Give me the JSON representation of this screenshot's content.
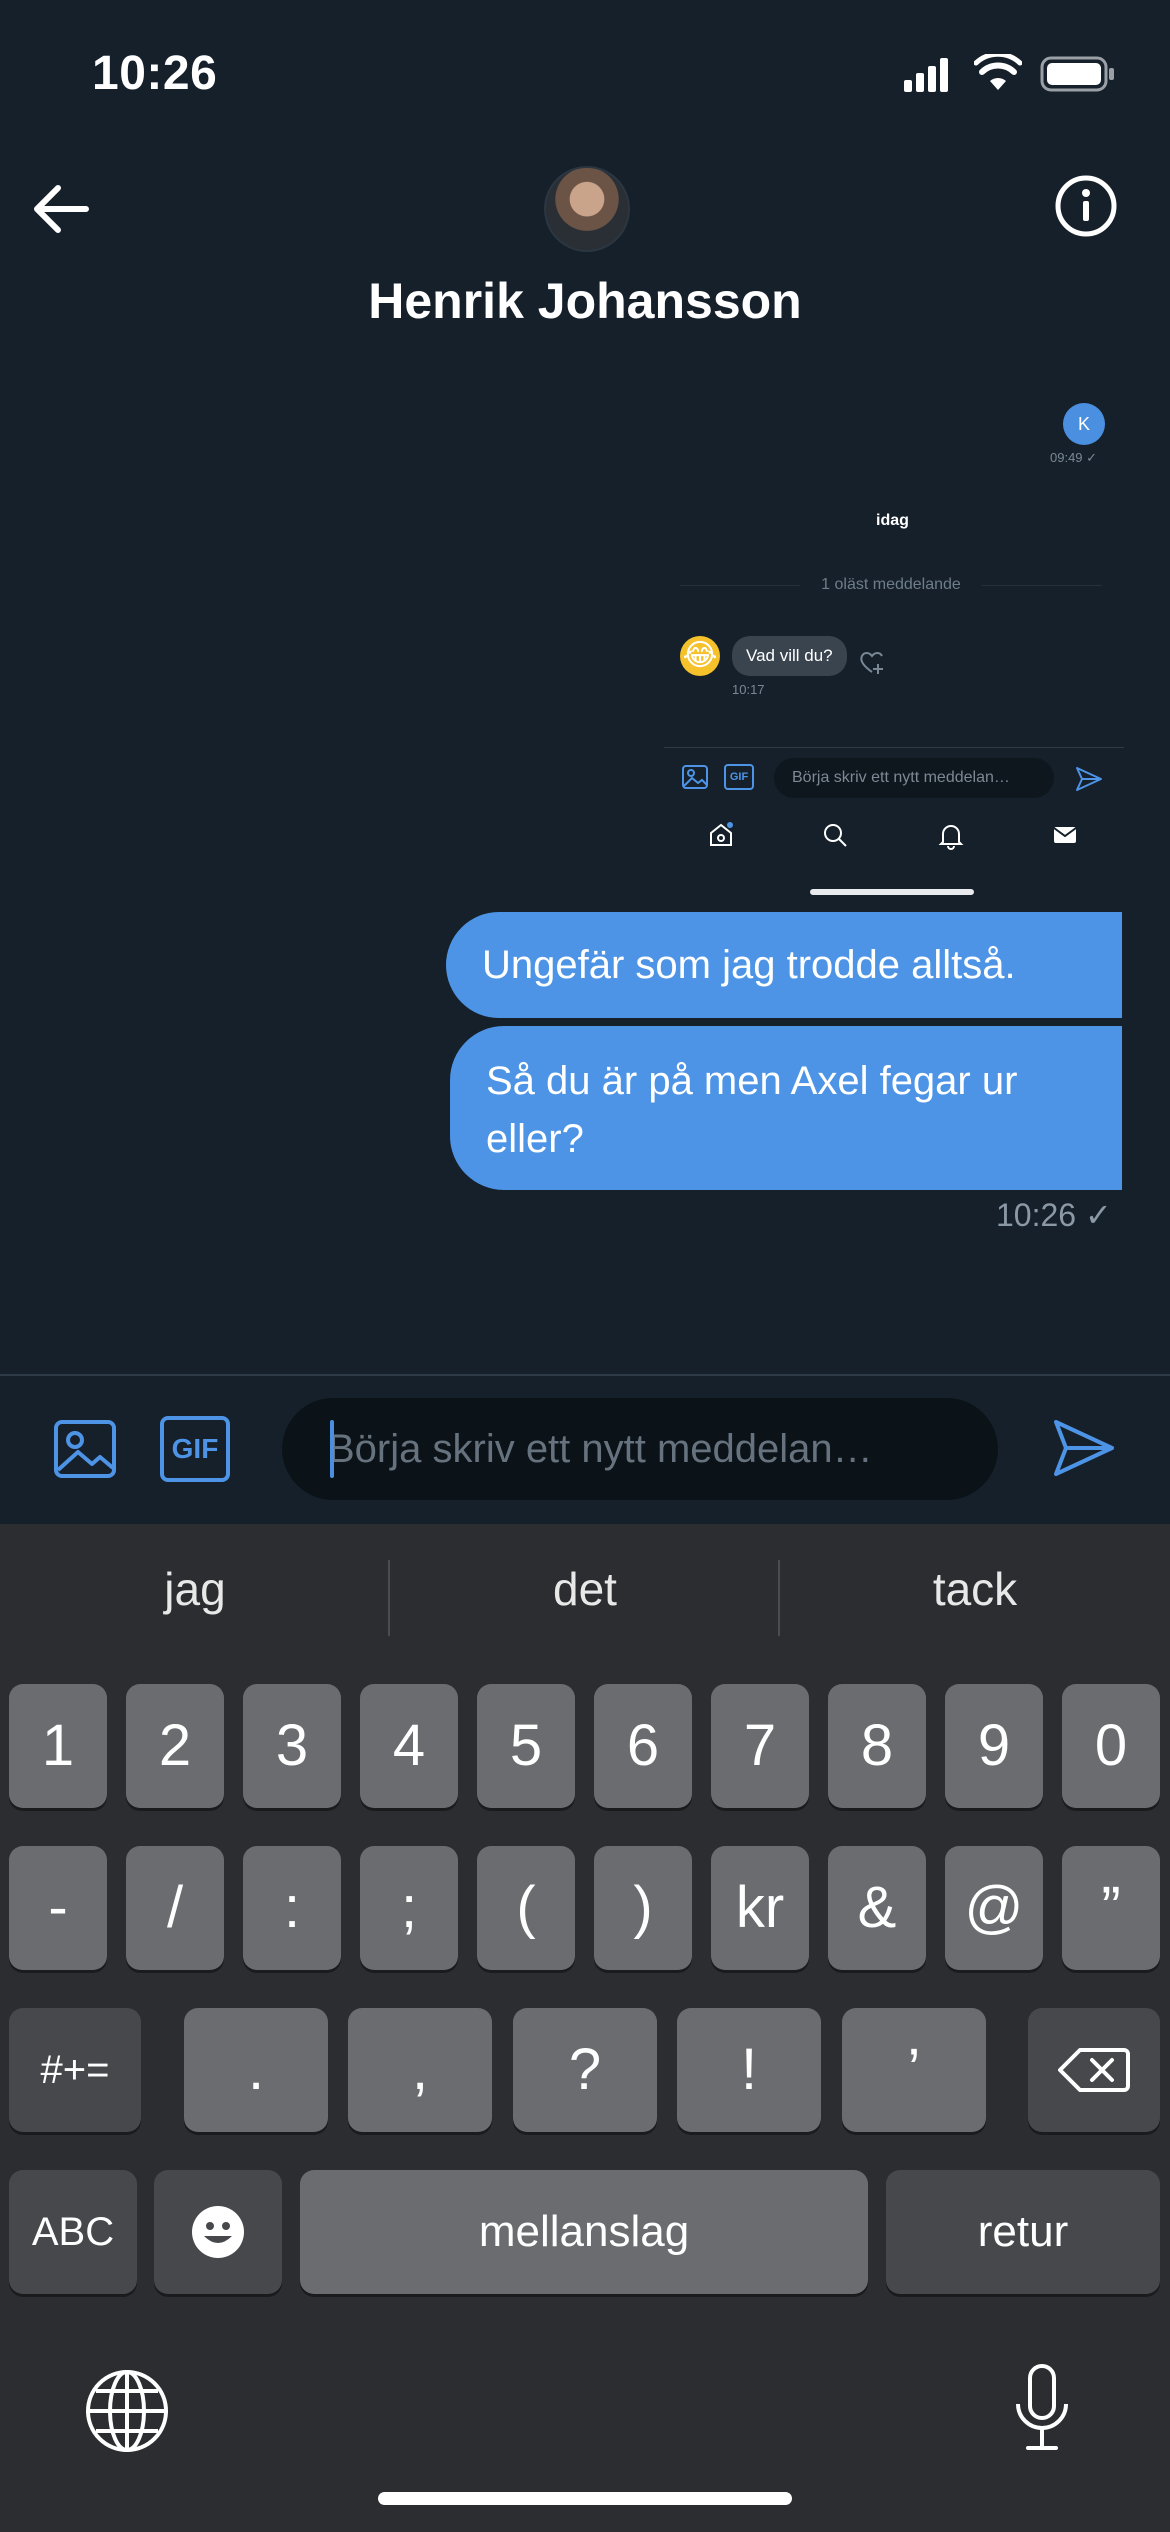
{
  "status_bar": {
    "time": "10:26"
  },
  "header": {
    "contact_name": "Henrik Johansson"
  },
  "embedded_screenshot": {
    "bubble_letter": "K",
    "bubble_time": "09:49 ✓",
    "date_divider": "idag",
    "unread_label": "1 oläst meddelande",
    "incoming_message": "Vad vill du?",
    "incoming_time": "10:17",
    "input_placeholder": "Börja skriv ett nytt meddelan…",
    "gif_label": "GIF"
  },
  "messages": [
    {
      "text": "Ungefär som jag trodde alltså."
    },
    {
      "text": "Så du är på men Axel fegar ur eller?"
    }
  ],
  "last_message_time": "10:26 ✓",
  "composer": {
    "placeholder": "Börja skriv ett nytt meddelan…",
    "gif_label": "GIF"
  },
  "keyboard": {
    "suggestions": [
      "jag",
      "det",
      "tack"
    ],
    "row1": [
      "1",
      "2",
      "3",
      "4",
      "5",
      "6",
      "7",
      "8",
      "9",
      "0"
    ],
    "row2": [
      "-",
      "/",
      ":",
      ";",
      "(",
      ")",
      "kr",
      "&",
      "@",
      "”"
    ],
    "row3_left": "#+=",
    "row3": [
      ".",
      ",",
      "?",
      "!",
      "’"
    ],
    "abc": "ABC",
    "space": "mellanslag",
    "return": "retur"
  },
  "colors": {
    "accent": "#4d94e6",
    "background": "#15202b"
  }
}
